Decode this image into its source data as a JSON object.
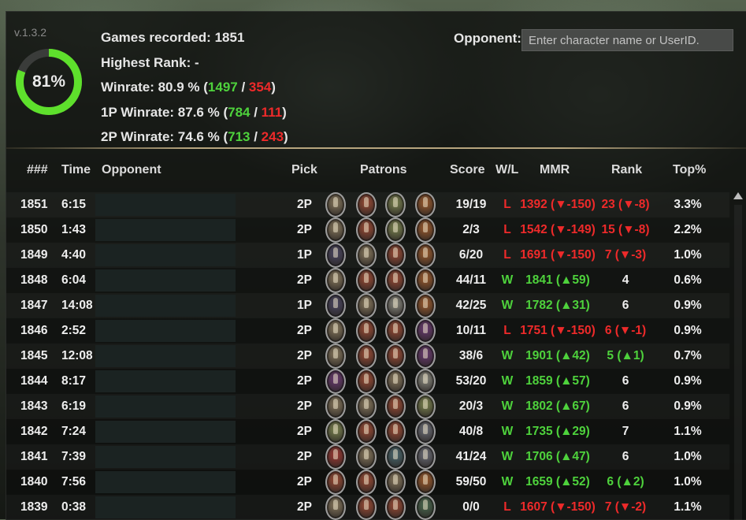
{
  "version": "v.1.3.2",
  "winrate_donut": {
    "percent_label": "81%",
    "percent": 80.9
  },
  "stats": {
    "games_label": "Games recorded:",
    "games_value": "1851",
    "rank_label": "Highest Rank:",
    "rank_value": "-",
    "winrate_label": "Winrate:",
    "winrate_value": "80.9 %",
    "winrate_wins": "1497",
    "winrate_losses": "354",
    "p1_label": "1P Winrate:",
    "p1_value": "87.6 %",
    "p1_wins": "784",
    "p1_losses": "111",
    "p2_label": "2P Winrate:",
    "p2_value": "74.6 %",
    "p2_wins": "713",
    "p2_losses": "243"
  },
  "opponent": {
    "label": "Opponent:",
    "placeholder": "Enter character name or UserID."
  },
  "columns": {
    "num": "###",
    "time": "Time",
    "opponent": "Opponent",
    "pick": "Pick",
    "patrons": "Patrons",
    "score": "Score",
    "wl": "W/L",
    "mmr": "MMR",
    "rank": "Rank",
    "top": "Top%"
  },
  "colors": {
    "win": "#4ed23c",
    "loss": "#ee2a2a",
    "accent_ring": "#5ee02c",
    "divider": "#b7a57e"
  },
  "rows": [
    {
      "num": "1851",
      "time": "6:15",
      "pick": "2P",
      "patrons": [
        "#86775c",
        "#9a4a34",
        "#7c8450",
        "#9c5a2c"
      ],
      "score": "19/19",
      "wl": "L",
      "mmr": "1392 (▼-150)",
      "rank": "23 (▼-8)",
      "top": "3.3%"
    },
    {
      "num": "1850",
      "time": "1:43",
      "pick": "2P",
      "patrons": [
        "#86775c",
        "#9a4a34",
        "#7c8450",
        "#9c5a2c"
      ],
      "score": "2/3",
      "wl": "L",
      "mmr": "1542 (▼-149)",
      "rank": "15 (▼-8)",
      "top": "2.2%"
    },
    {
      "num": "1849",
      "time": "4:40",
      "pick": "1P",
      "patrons": [
        "#4a4662",
        "#86775c",
        "#9a4a34",
        "#9c5a2c"
      ],
      "score": "6/20",
      "wl": "L",
      "mmr": "1691 (▼-150)",
      "rank": "7 (▼-3)",
      "top": "1.0%"
    },
    {
      "num": "1848",
      "time": "6:04",
      "pick": "2P",
      "patrons": [
        "#86775c",
        "#9a4a34",
        "#9a4a34",
        "#9c5a2c"
      ],
      "score": "44/11",
      "wl": "W",
      "mmr": "1841 (▲59)",
      "rank": "4",
      "top": "0.6%"
    },
    {
      "num": "1847",
      "time": "14:08",
      "pick": "1P",
      "patrons": [
        "#4a4662",
        "#86775c",
        "#8a8a80",
        "#9c5a2c"
      ],
      "score": "42/25",
      "wl": "W",
      "mmr": "1782 (▲31)",
      "rank": "6",
      "top": "0.9%"
    },
    {
      "num": "1846",
      "time": "2:52",
      "pick": "2P",
      "patrons": [
        "#86775c",
        "#9a4a34",
        "#9a4a34",
        "#6a3a72"
      ],
      "score": "10/11",
      "wl": "L",
      "mmr": "1751 (▼-150)",
      "rank": "6 (▼-1)",
      "top": "0.9%"
    },
    {
      "num": "1845",
      "time": "12:08",
      "pick": "2P",
      "patrons": [
        "#86775c",
        "#9a4a34",
        "#9a4a34",
        "#6a3a72"
      ],
      "score": "38/6",
      "wl": "W",
      "mmr": "1901 (▲42)",
      "rank": "5 (▲1)",
      "top": "0.7%"
    },
    {
      "num": "1844",
      "time": "8:17",
      "pick": "2P",
      "patrons": [
        "#6a3a72",
        "#9a4a34",
        "#86775c",
        "#8a8a80"
      ],
      "score": "53/20",
      "wl": "W",
      "mmr": "1859 (▲57)",
      "rank": "6",
      "top": "0.9%"
    },
    {
      "num": "1843",
      "time": "6:19",
      "pick": "2P",
      "patrons": [
        "#86775c",
        "#86775c",
        "#9a4a34",
        "#7c8450"
      ],
      "score": "20/3",
      "wl": "W",
      "mmr": "1802 (▲67)",
      "rank": "6",
      "top": "0.9%"
    },
    {
      "num": "1842",
      "time": "7:24",
      "pick": "2P",
      "patrons": [
        "#7c8450",
        "#9a4a34",
        "#9a4a34",
        "#6b6e78"
      ],
      "score": "40/8",
      "wl": "W",
      "mmr": "1735 (▲29)",
      "rank": "7",
      "top": "1.1%"
    },
    {
      "num": "1841",
      "time": "7:39",
      "pick": "2P",
      "patrons": [
        "#a03a34",
        "#86775c",
        "#4a6a70",
        "#6b6e78"
      ],
      "score": "41/24",
      "wl": "W",
      "mmr": "1706 (▲47)",
      "rank": "6",
      "top": "1.0%"
    },
    {
      "num": "1840",
      "time": "7:56",
      "pick": "2P",
      "patrons": [
        "#9a4a34",
        "#9a4a34",
        "#86775c",
        "#9c5a2c"
      ],
      "score": "59/50",
      "wl": "W",
      "mmr": "1659 (▲52)",
      "rank": "6 (▲2)",
      "top": "1.0%"
    },
    {
      "num": "1839",
      "time": "0:38",
      "pick": "2P",
      "patrons": [
        "#86775c",
        "#9a4a34",
        "#9a4a34",
        "#4a6a50"
      ],
      "score": "0/0",
      "wl": "L",
      "mmr": "1607 (▼-150)",
      "rank": "7 (▼-2)",
      "top": "1.1%"
    }
  ]
}
